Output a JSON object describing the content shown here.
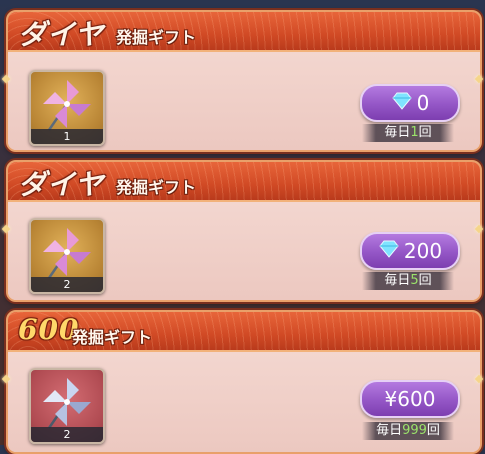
{
  "cards": [
    {
      "title_main": "ダイヤ",
      "title_sub": "発掘ギフト",
      "item_count": "1",
      "item_icon": "pinwheel-icon",
      "price_type": "gem",
      "price": "0",
      "daily_prefix": "毎日",
      "daily_num": "1",
      "daily_suffix": "回"
    },
    {
      "title_main": "ダイヤ",
      "title_sub": "発掘ギフト",
      "item_count": "2",
      "item_icon": "pinwheel-icon",
      "price_type": "gem",
      "price": "200",
      "daily_prefix": "毎日",
      "daily_num": "5",
      "daily_suffix": "回"
    },
    {
      "title_main": "600",
      "title_sub": "発掘ギフト",
      "item_count": "2",
      "item_icon": "pinwheel-icon",
      "price_type": "yen",
      "price": "¥600",
      "daily_prefix": "毎日",
      "daily_num": "999",
      "daily_suffix": "回"
    }
  ],
  "colors": {
    "header": "#d14a25",
    "button": "#9456c6",
    "count_highlight": "#9be36a"
  }
}
